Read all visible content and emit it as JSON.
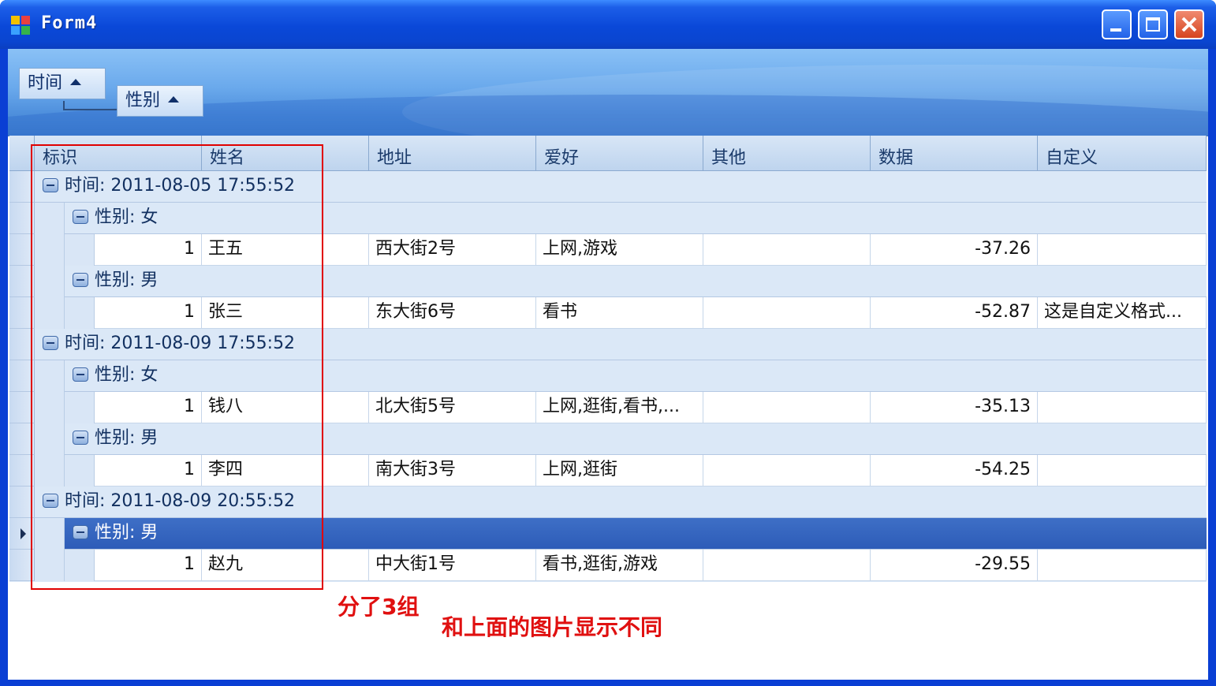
{
  "window": {
    "title": "Form4"
  },
  "group_panel": {
    "chips": [
      {
        "label": "时间"
      },
      {
        "label": "性别"
      }
    ]
  },
  "grid": {
    "columns": [
      "标识",
      "姓名",
      "地址",
      "爱好",
      "其他",
      "数据",
      "自定义"
    ],
    "groups": [
      {
        "label": "时间: 2011-08-05 17:55:52",
        "sub": [
          {
            "label": "性别: 女",
            "rows": [
              {
                "id": "1",
                "name": "王五",
                "addr": "西大街2号",
                "hobby": "上网,游戏",
                "other": "",
                "data": "-37.26",
                "custom": ""
              }
            ]
          },
          {
            "label": "性别: 男",
            "rows": [
              {
                "id": "1",
                "name": "张三",
                "addr": "东大街6号",
                "hobby": "看书",
                "other": "",
                "data": "-52.87",
                "custom": "这是自定义格式..."
              }
            ]
          }
        ]
      },
      {
        "label": "时间: 2011-08-09 17:55:52",
        "sub": [
          {
            "label": "性别: 女",
            "rows": [
              {
                "id": "1",
                "name": "钱八",
                "addr": "北大街5号",
                "hobby": "上网,逛街,看书,...",
                "other": "",
                "data": "-35.13",
                "custom": ""
              }
            ]
          },
          {
            "label": "性别: 男",
            "rows": [
              {
                "id": "1",
                "name": "李四",
                "addr": "南大街3号",
                "hobby": "上网,逛街",
                "other": "",
                "data": "-54.25",
                "custom": ""
              }
            ]
          }
        ]
      },
      {
        "label": "时间: 2011-08-09 20:55:52",
        "sub": [
          {
            "label": "性别: 男",
            "selected": true,
            "rows": [
              {
                "id": "1",
                "name": "赵九",
                "addr": "中大街1号",
                "hobby": "看书,逛街,游戏",
                "other": "",
                "data": "-29.55",
                "custom": ""
              }
            ]
          }
        ]
      }
    ]
  },
  "annotations": {
    "note1": "分了3组",
    "note2": "和上面的图片显示不同"
  },
  "colors": {
    "selection": "#2d5cb8",
    "annotation": "#e01010",
    "titlebar": "#0a48d8"
  }
}
